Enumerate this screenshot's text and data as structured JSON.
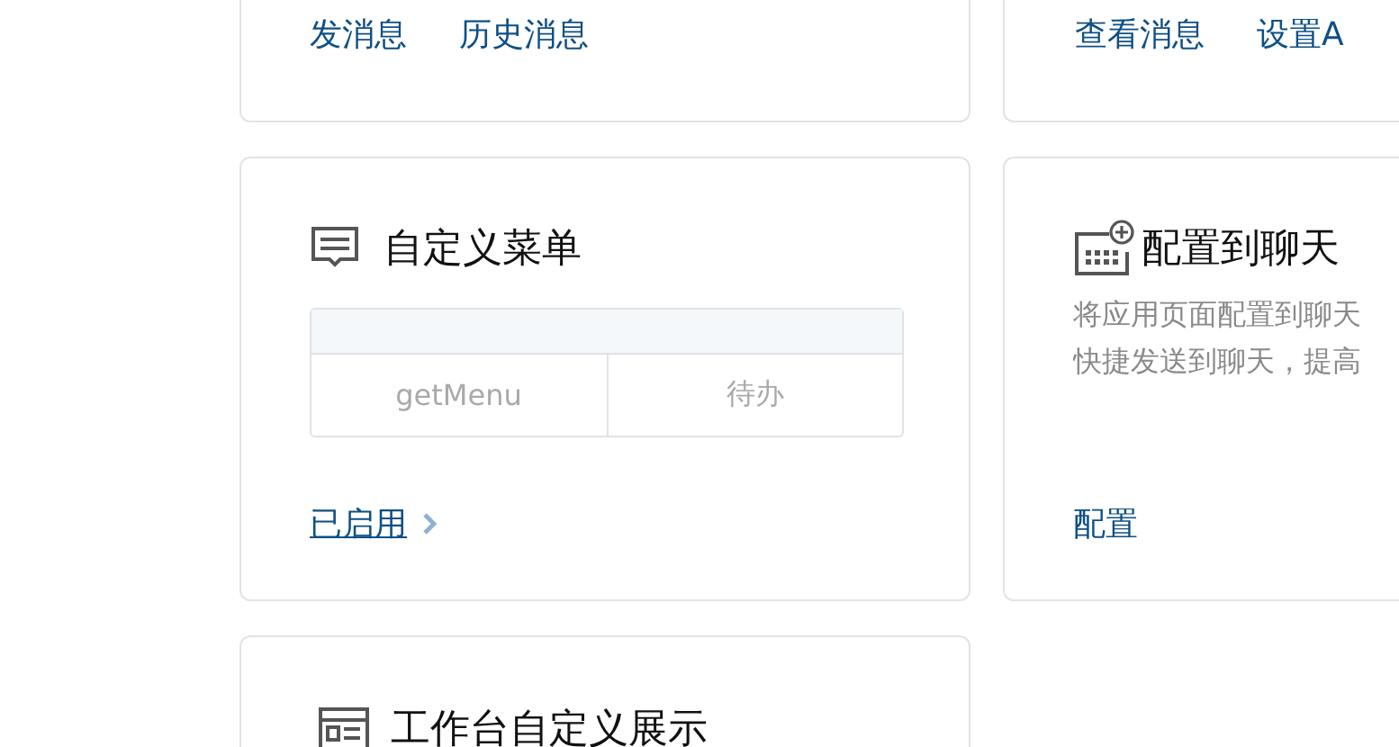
{
  "message_cards": [
    {
      "links": [
        "发消息",
        "历史消息"
      ]
    },
    {
      "links": [
        "查看消息",
        "设置A"
      ]
    }
  ],
  "custom_menu": {
    "title": "自定义菜单",
    "table": {
      "rows": [
        [
          "getMenu",
          "待办"
        ]
      ]
    },
    "status_link": "已启用"
  },
  "chat_attachment": {
    "title": "配置到聊天",
    "description": [
      "将应用页面配置到聊天",
      "快捷发送到聊天，提高"
    ],
    "action": "配置"
  },
  "workbench": {
    "title": "工作台自定义展示"
  }
}
